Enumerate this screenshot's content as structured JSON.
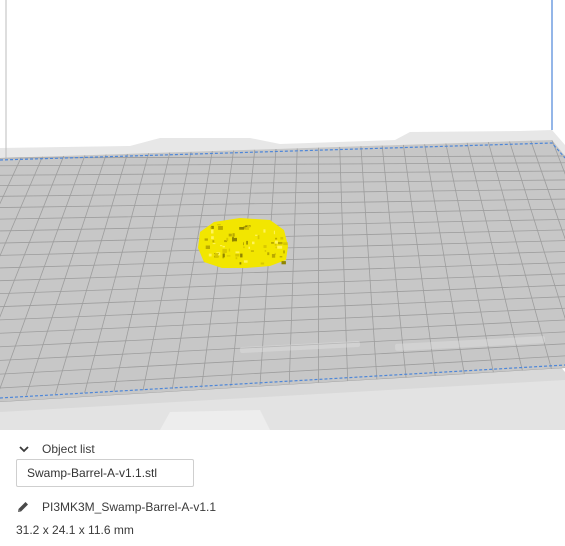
{
  "object_list": {
    "header_label": "Object list",
    "chevron_icon": "chevron-down-icon",
    "file_name": "Swamp-Barrel-A-v1.1.stl"
  },
  "job": {
    "edit_icon": "pencil-icon",
    "name": "PI3MK3M_Swamp-Barrel-A-v1.1"
  },
  "model": {
    "dimensions": "31.2 x 24.1 x 11.6 mm",
    "color": "#f2e600"
  },
  "build_plate": {
    "plate_color": "#c7c7c7",
    "grid_color": "#9d9d9d",
    "boundary_color": "#4d86d8"
  }
}
